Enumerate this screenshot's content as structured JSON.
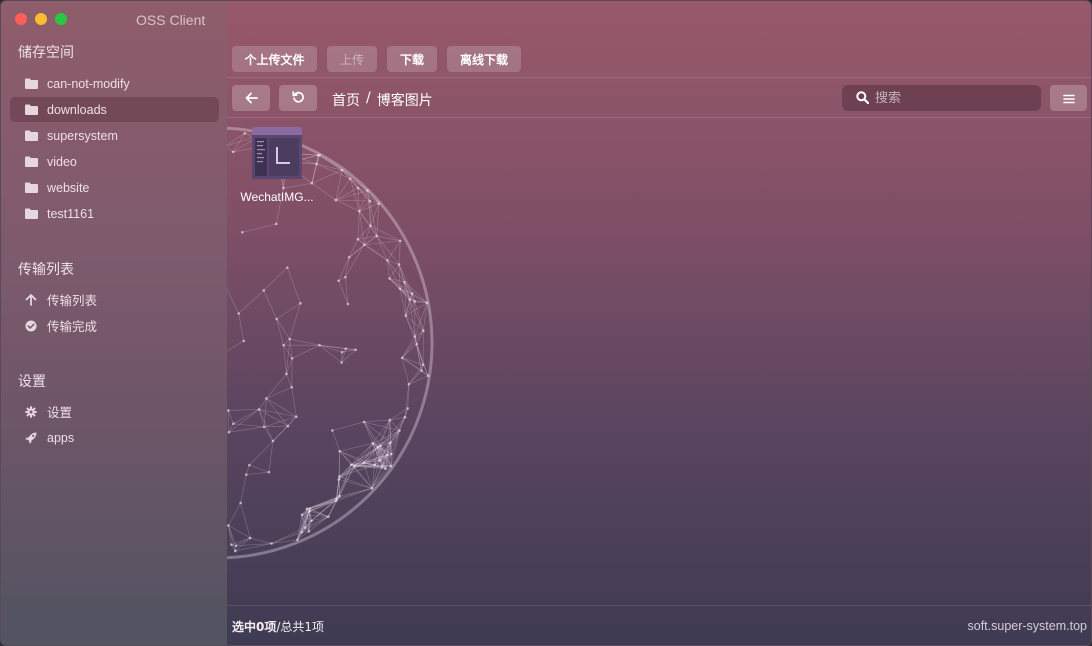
{
  "window": {
    "title": "OSS Client"
  },
  "sidebar": {
    "storage_title": "储存空间",
    "buckets": [
      {
        "label": "can-not-modify",
        "icon": "folder-icon",
        "active": false
      },
      {
        "label": "downloads",
        "icon": "folder-icon",
        "active": true
      },
      {
        "label": "supersystem",
        "icon": "folder-icon",
        "active": false
      },
      {
        "label": "video",
        "icon": "folder-icon",
        "active": false
      },
      {
        "label": "website",
        "icon": "folder-icon",
        "active": false
      },
      {
        "label": "test1161",
        "icon": "folder-icon",
        "active": false
      }
    ],
    "transfer_title": "传输列表",
    "transfer_items": [
      {
        "label": "传输列表",
        "icon": "arrow-up-icon"
      },
      {
        "label": "传输完成",
        "icon": "check-circle-icon"
      }
    ],
    "settings_title": "设置",
    "settings_items": [
      {
        "label": "设置",
        "icon": "gear-icon"
      },
      {
        "label": "apps",
        "icon": "rocket-icon"
      }
    ]
  },
  "toolbar": {
    "upload_file": "个上传文件",
    "upload": "上传",
    "download": "下载",
    "offline_download": "离线下载"
  },
  "nav": {
    "breadcrumb": [
      "首页",
      "/",
      "博客图片"
    ],
    "search_placeholder": "搜索"
  },
  "files": [
    {
      "name": "WechatIMG..."
    }
  ],
  "status": {
    "selected": "选中0项",
    "total": "/总共1项",
    "site": "soft.super-system.top"
  },
  "colors": {
    "traffic_close": "#ff5f57",
    "traffic_min": "#febc2e",
    "traffic_max": "#28c840"
  }
}
